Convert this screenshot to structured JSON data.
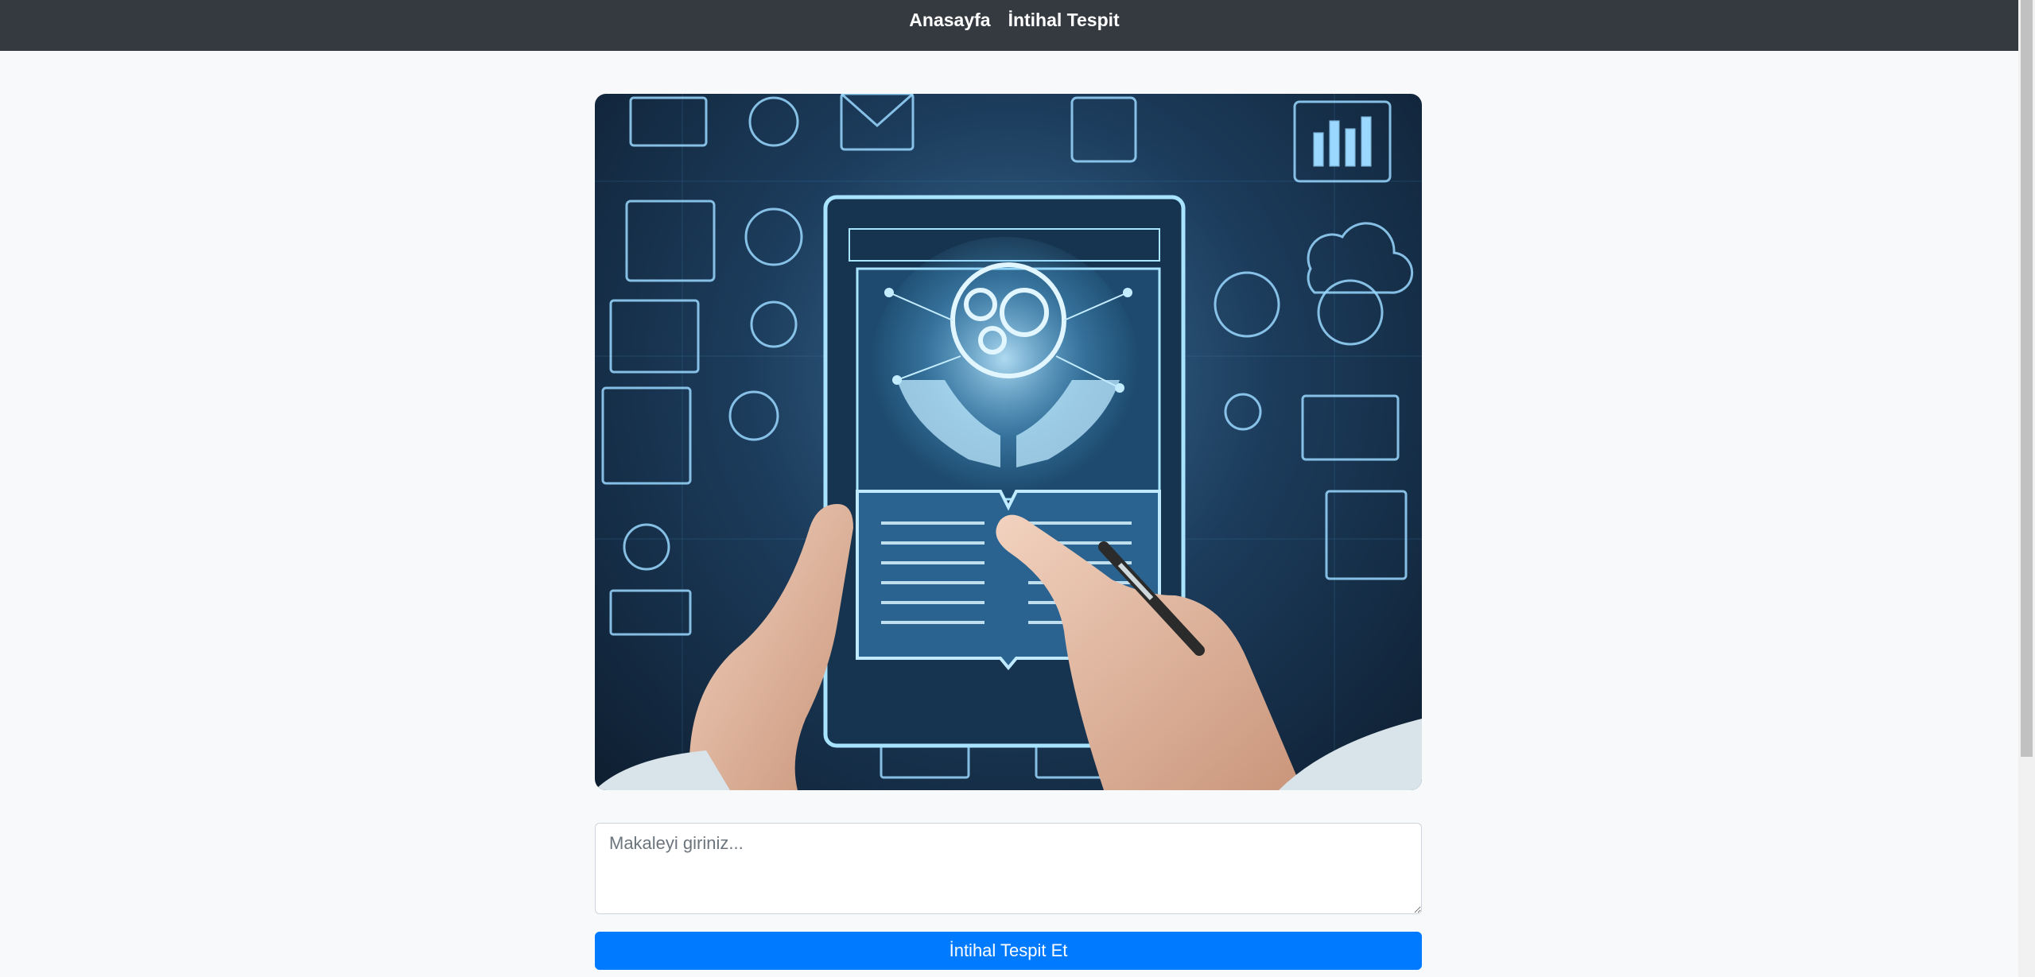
{
  "navbar": {
    "links": [
      {
        "label": "Anasayfa"
      },
      {
        "label": "İntihal Tespit"
      }
    ]
  },
  "hero_image": {
    "description_icon": "plagiarism-illustration"
  },
  "form": {
    "article_placeholder": "Makaleyi giriniz...",
    "article_value": "",
    "submit_label": "İntihal Tespit Et"
  },
  "colors": {
    "navbar_bg": "#343a40",
    "page_bg": "#f8f9fa",
    "button_bg": "#007bff",
    "button_text": "#ffffff"
  }
}
